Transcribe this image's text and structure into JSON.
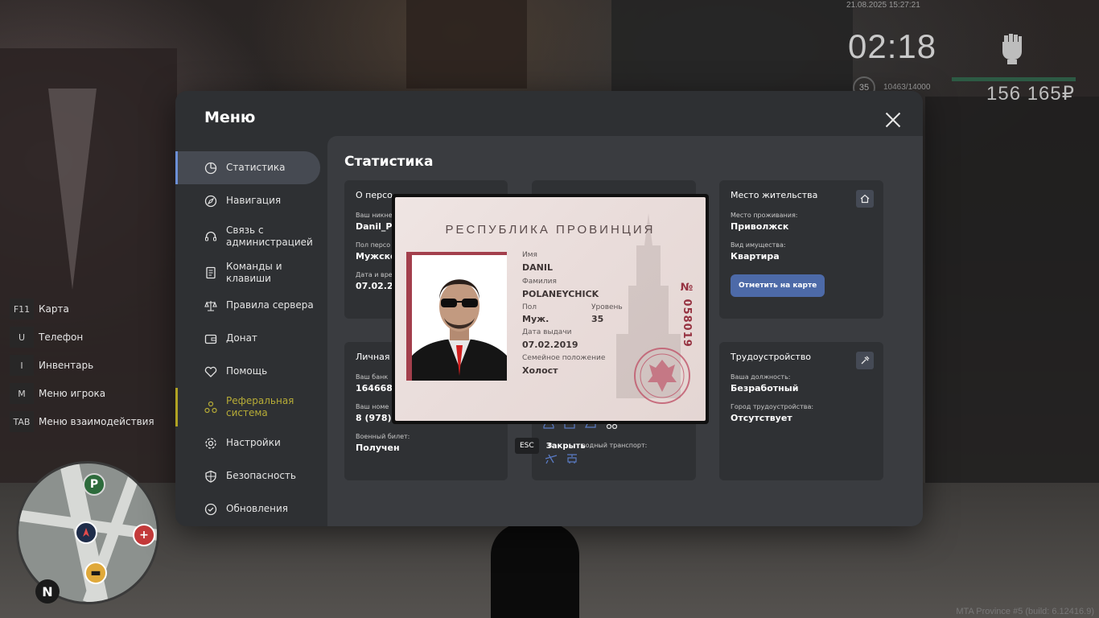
{
  "hud": {
    "datetime": "21.08.2025 15:27:21",
    "clock": "02:18",
    "level": "35",
    "xp": "10463/14000",
    "money": "156 165₽"
  },
  "keybinds": [
    {
      "key": "F11",
      "label": "Карта"
    },
    {
      "key": "U",
      "label": "Телефон"
    },
    {
      "key": "I",
      "label": "Инвентарь"
    },
    {
      "key": "M",
      "label": "Меню игрока"
    },
    {
      "key": "TAB",
      "label": "Меню взаимодействия"
    }
  ],
  "build_info": "MTA Province #5 (build: 6.12416.9)",
  "menu": {
    "title": "Меню",
    "nav": [
      {
        "label": "Статистика",
        "icon": "chart-pie-icon"
      },
      {
        "label": "Навигация",
        "icon": "compass-icon"
      },
      {
        "label": "Связь с администрацией",
        "icon": "headset-icon"
      },
      {
        "label": "Команды и клавиши",
        "icon": "document-icon"
      },
      {
        "label": "Правила сервера",
        "icon": "scales-icon"
      },
      {
        "label": "Донат",
        "icon": "wallet-icon"
      },
      {
        "label": "Помощь",
        "icon": "heart-hand-icon"
      },
      {
        "label": "Реферальная система",
        "icon": "referral-icon"
      },
      {
        "label": "Настройки",
        "icon": "gear-icon"
      },
      {
        "label": "Безопасность",
        "icon": "shield-icon"
      },
      {
        "label": "Обновления",
        "icon": "refresh-check-icon"
      }
    ],
    "content_title": "Статистика",
    "cards": {
      "about": {
        "title": "О персо",
        "f1_label": "Ваш никне",
        "f1_value": "Danil_P",
        "f2_label": "Пол персо",
        "f2_value": "Мужско",
        "f3_label": "Дата и вре",
        "f3_value": "07.02.2"
      },
      "residence": {
        "title": "Место жительства",
        "f1_label": "Место проживания:",
        "f1_value": "Приволжск",
        "f2_label": "Вид имущества:",
        "f2_value": "Квартира",
        "button": "Отметить на карте"
      },
      "personal": {
        "title": "Личная",
        "f1_label": "Ваш банк",
        "f1_value": "164668",
        "f2_label": "Ваш номе",
        "f2_value": "8 (978)",
        "f3_label": "Военный билет:",
        "f3_value": "Получен"
      },
      "transport": {
        "water_label": "водный транспорт:",
        "water_prefix": "В"
      },
      "employment": {
        "title": "Трудоустройство",
        "f1_label": "Ваша должность:",
        "f1_value": "Безработный",
        "f2_label": "Город трудоустройства:",
        "f2_value": "Отсутствует"
      }
    },
    "esc_key": "ESC",
    "esc_label": "Закрыть"
  },
  "idcard": {
    "header": "РЕСПУБЛИКА ПРОВИНЦИЯ",
    "number": "№ 058019",
    "name_label": "Имя",
    "name": "DANIL",
    "surname_label": "Фамилия",
    "surname": "POLANEYCHICK",
    "sex_label": "Пол",
    "sex": "Муж.",
    "level_label": "Уровень",
    "level": "35",
    "issue_label": "Дата выдачи",
    "issue": "07.02.2019",
    "marital_label": "Семейное положение",
    "marital": "Холост"
  },
  "colors": {
    "accent_blue": "#6c8fd6",
    "hover_yellow": "#b7ac37",
    "panel": "#2e3033",
    "card": "#2f3134",
    "id_red": "#963241"
  }
}
